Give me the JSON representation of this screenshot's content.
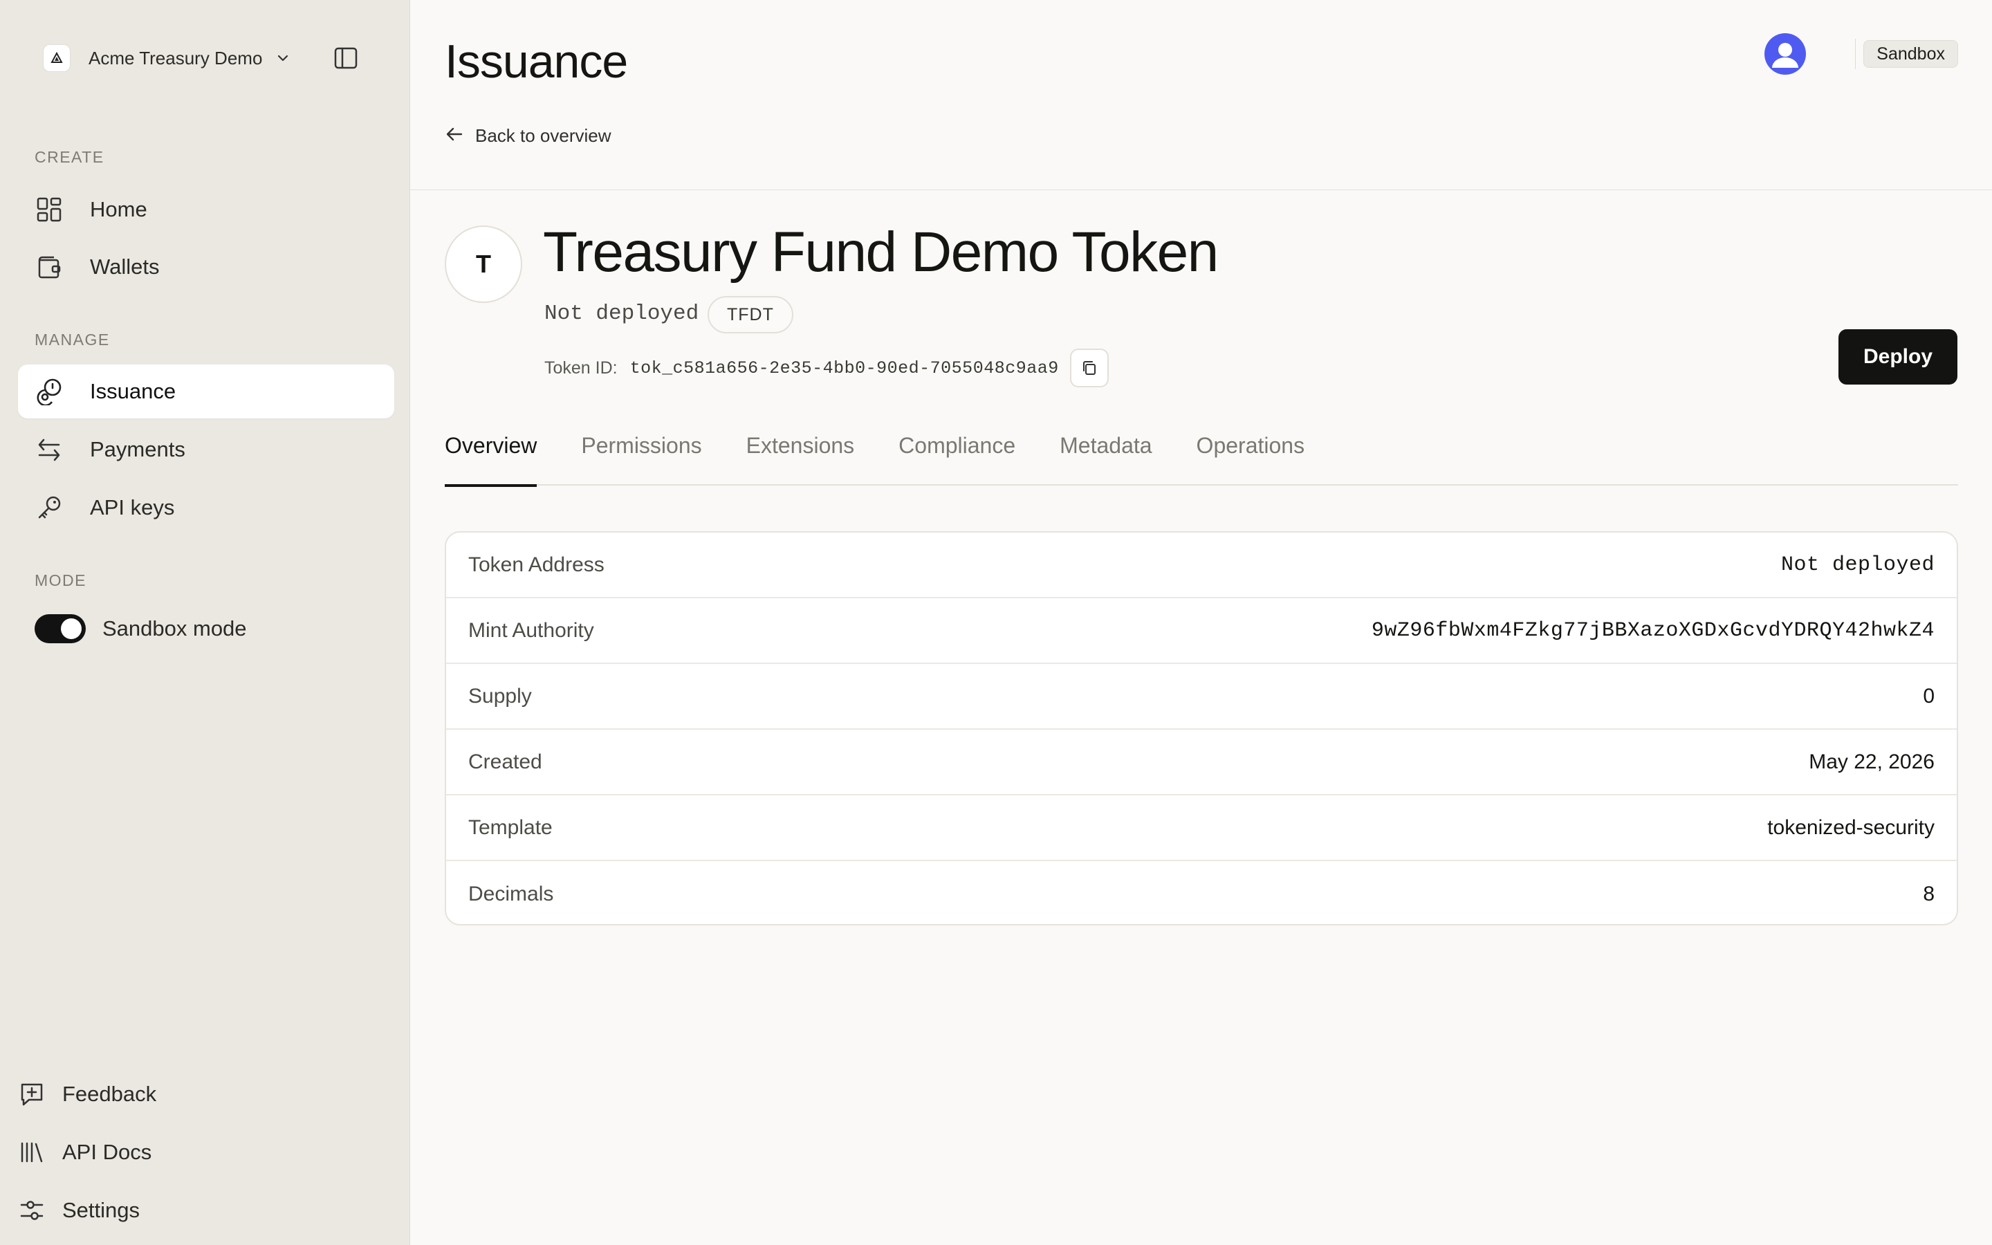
{
  "org": {
    "name": "Acme Treasury Demo",
    "logo_icon": "triangle-logo-icon"
  },
  "sidebar": {
    "sections": {
      "create": "CREATE",
      "manage": "MANAGE",
      "mode": "MODE"
    },
    "create_items": [
      {
        "label": "Home",
        "icon": "grid-icon"
      },
      {
        "label": "Wallets",
        "icon": "wallet-icon"
      }
    ],
    "manage_items": [
      {
        "label": "Issuance",
        "icon": "coins-icon",
        "active": true
      },
      {
        "label": "Payments",
        "icon": "arrows-swap-icon"
      },
      {
        "label": "API keys",
        "icon": "key-icon"
      }
    ],
    "mode_toggle": {
      "label": "Sandbox mode",
      "on": true
    },
    "footer_items": [
      {
        "label": "Feedback",
        "icon": "message-plus-icon"
      },
      {
        "label": "API Docs",
        "icon": "library-icon"
      },
      {
        "label": "Settings",
        "icon": "sliders-icon"
      }
    ]
  },
  "header": {
    "title": "Issuance",
    "back_label": "Back to overview",
    "env_badge": "Sandbox"
  },
  "token": {
    "initial": "T",
    "name": "Treasury Fund Demo Token",
    "status": "Not deployed",
    "symbol": "TFDT",
    "id_label": "Token ID:",
    "id_value": "tok_c581a656-2e35-4bb0-90ed-7055048c9aa9",
    "deploy_label": "Deploy"
  },
  "tabs": [
    {
      "label": "Overview",
      "active": true
    },
    {
      "label": "Permissions"
    },
    {
      "label": "Extensions"
    },
    {
      "label": "Compliance"
    },
    {
      "label": "Metadata"
    },
    {
      "label": "Operations"
    }
  ],
  "details": [
    {
      "label": "Token Address",
      "value": "Not deployed",
      "mono": true
    },
    {
      "label": "Mint Authority",
      "value": "9wZ96fbWxm4FZkg77jBBXazoXGDxGcvdYDRQY42hwkZ4",
      "mono": true
    },
    {
      "label": "Supply",
      "value": "0"
    },
    {
      "label": "Created",
      "value": "May 22, 2026"
    },
    {
      "label": "Template",
      "value": "tokenized-security"
    },
    {
      "label": "Decimals",
      "value": "8"
    }
  ],
  "colors": {
    "sidebar_bg": "#ebe8e1",
    "main_bg": "#faf9f7",
    "primary": "#131311",
    "avatar": "#4f5bf0"
  }
}
